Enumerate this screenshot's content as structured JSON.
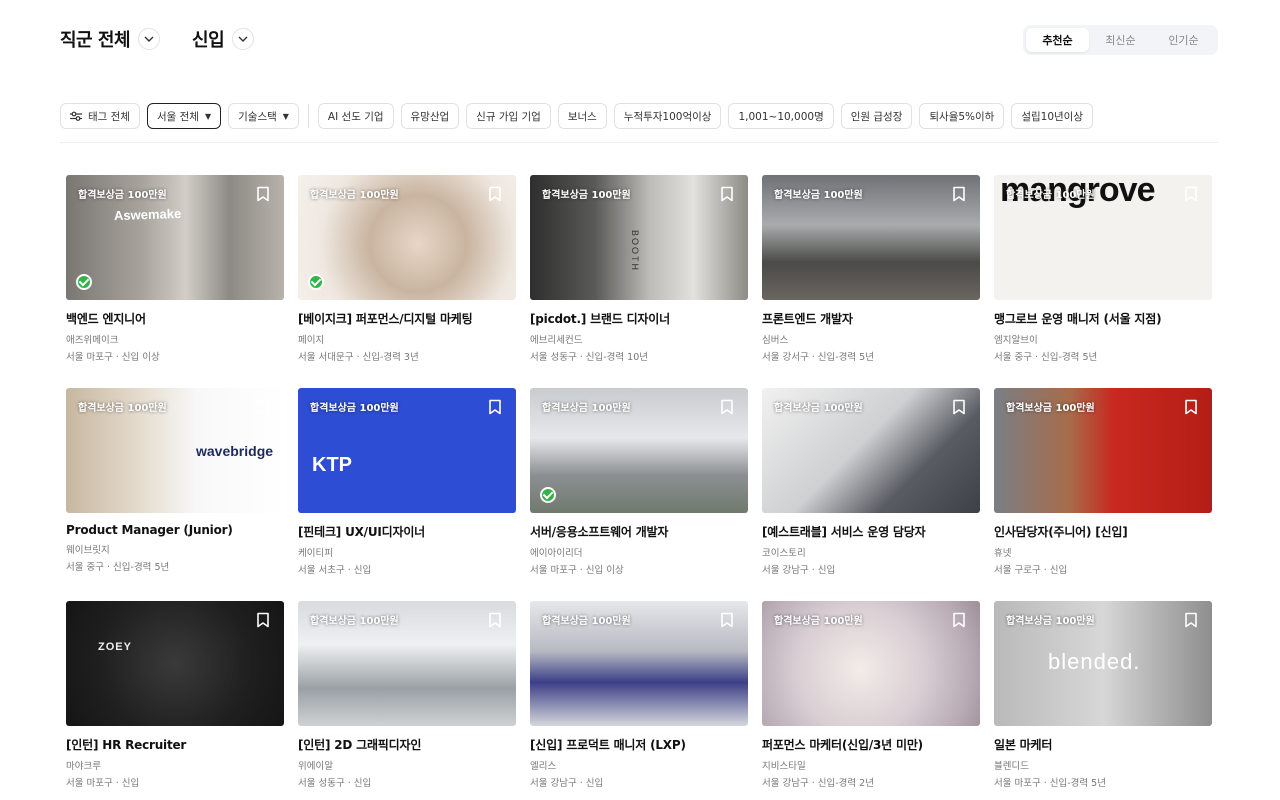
{
  "header": {
    "job_filter": "직군 전체",
    "career_filter": "신입"
  },
  "sort_tabs": [
    {
      "label": "추천순",
      "active": true
    },
    {
      "label": "최신순",
      "active": false
    },
    {
      "label": "인기순",
      "active": false
    }
  ],
  "filters": {
    "tag_all": "태그 전체",
    "location": "서울 전체",
    "tech_stack": "기술스택",
    "tags": [
      "AI 선도 기업",
      "유망산업",
      "신규 가입 기업",
      "보너스",
      "누적투자100억이상",
      "1,001~10,000명",
      "인원 급성장",
      "퇴사율5%이하",
      "설립10년이상"
    ]
  },
  "colors": {
    "check_green": "#36b24a",
    "selected_border": "#222222",
    "ktp_blue": "#2d4ed4"
  },
  "cards": [
    {
      "badge": "합격보상금 100만원",
      "title": "백엔드 엔지니어",
      "company": "애즈위메이크",
      "location": "서울 마포구 · 신입 이상",
      "verified": true,
      "thumb_text": "Aswemake"
    },
    {
      "badge": "합격보상금 100만원",
      "title": "[베이지크] 퍼포먼스/디지털 마케팅",
      "company": "페이지",
      "location": "서울 서대문구 · 신입-경력 3년",
      "verified": true,
      "thumb_text": ""
    },
    {
      "badge": "합격보상금 100만원",
      "title": "[picdot.] 브랜드 디자이너",
      "company": "에브리세컨드",
      "location": "서울 성동구 · 신입-경력 10년",
      "verified": false,
      "thumb_text": "BOOTH"
    },
    {
      "badge": "합격보상금 100만원",
      "title": "프론트엔드 개발자",
      "company": "심버스",
      "location": "서울 강서구 · 신입-경력 5년",
      "verified": false,
      "thumb_text": ""
    },
    {
      "badge": "합격보상금 100만원",
      "title": "맹그로브 운영 매니저 (서울 지점)",
      "company": "엠지알브이",
      "location": "서울 중구 · 신입-경력 5년",
      "verified": false,
      "thumb_text": "mangrove"
    },
    {
      "badge": "합격보상금 100만원",
      "title": "Product Manager (Junior)",
      "company": "웨이브릿지",
      "location": "서울 중구 · 신입-경력 5년",
      "verified": false,
      "thumb_text": "wavebridge"
    },
    {
      "badge": "합격보상금 100만원",
      "title": "[핀테크] UX/UI디자이너",
      "company": "케이티피",
      "location": "서울 서초구 · 신입",
      "verified": false,
      "thumb_text": "KTP"
    },
    {
      "badge": "합격보상금 100만원",
      "title": "서버/응용소프트웨어 개발자",
      "company": "에이아이리더",
      "location": "서울 마포구 · 신입 이상",
      "verified": true,
      "thumb_text": ""
    },
    {
      "badge": "합격보상금 100만원",
      "title": "[예스트래블] 서비스 운영 담당자",
      "company": "코이스토리",
      "location": "서울 강남구 · 신입",
      "verified": false,
      "thumb_text": ""
    },
    {
      "badge": "합격보상금 100만원",
      "title": "인사담당자(주니어) [신입]",
      "company": "휴넷",
      "location": "서울 구로구 · 신입",
      "verified": false,
      "thumb_text": ""
    },
    {
      "badge": "",
      "title": "[인턴] HR Recruiter",
      "company": "마야크루",
      "location": "서울 마포구 · 신입",
      "verified": false,
      "thumb_text": "ZOEY"
    },
    {
      "badge": "합격보상금 100만원",
      "title": "[인턴] 2D 그래픽디자인",
      "company": "위에이알",
      "location": "서울 성동구 · 신입",
      "verified": false,
      "thumb_text": ""
    },
    {
      "badge": "합격보상금 100만원",
      "title": "[신입] 프로덕트 매니저 (LXP)",
      "company": "엘리스",
      "location": "서울 강남구 · 신입",
      "verified": false,
      "thumb_text": ""
    },
    {
      "badge": "합격보상금 100만원",
      "title": "퍼포먼스 마케터(신입/3년 미만)",
      "company": "지비스타일",
      "location": "서울 강남구 · 신입-경력 2년",
      "verified": false,
      "thumb_text": ""
    },
    {
      "badge": "합격보상금 100만원",
      "title": "일본 마케터",
      "company": "블렌디드",
      "location": "서울 마포구 · 신입-경력 5년",
      "verified": false,
      "thumb_text": "blended."
    }
  ]
}
